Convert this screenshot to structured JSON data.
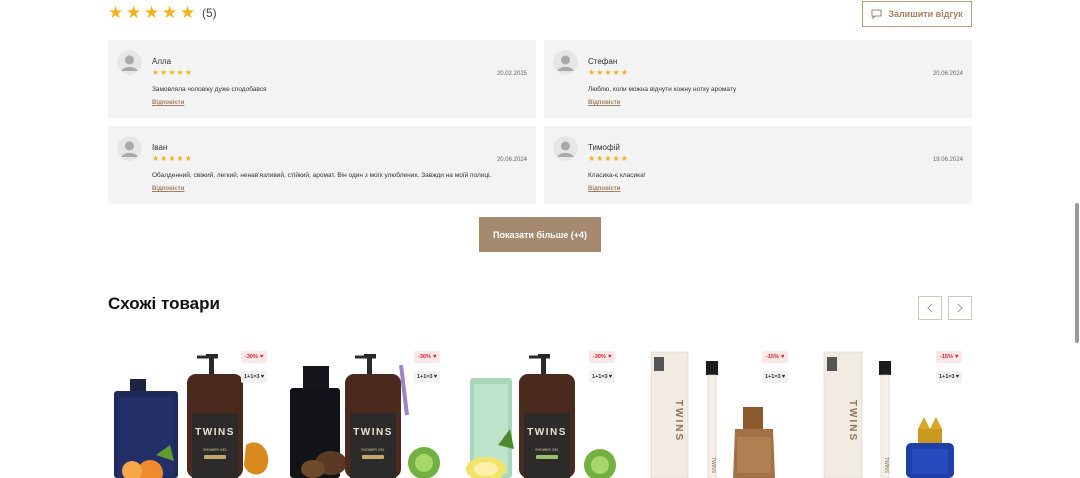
{
  "rating": {
    "stars": 5,
    "count_label": "(5)",
    "star_color": "#f2b21c"
  },
  "leave_review": {
    "label": "Залишити відгук",
    "icon": "comment-icon"
  },
  "reviews": [
    {
      "name": "Алла",
      "date": "20.02.2025",
      "text": "Замовляла чоловіку дуже сподобався",
      "reply": "Відповісти",
      "stars": 5
    },
    {
      "name": "Стефан",
      "date": "20.06.2024",
      "text": "Люблю, коли можна відчути кожну нотку аромату",
      "reply": "Відповісти",
      "stars": 5
    },
    {
      "name": "Іван",
      "date": "20.06.2024",
      "text": "Обалденний, свіжий, легкий, ненав'язливий, стійкий, аромат. Він один з моїх улюблених. Завжди на моїй полиці.",
      "reply": "Відповісти",
      "stars": 5
    },
    {
      "name": "Тимофій",
      "date": "19.06.2024",
      "text": "Класика-є класика!",
      "reply": "Відповісти",
      "stars": 5
    }
  ],
  "show_more": {
    "label": "Показати більше (+4)"
  },
  "similar": {
    "title": "Схожі товари",
    "prev_icon": "chevron-left-icon",
    "next_icon": "chevron-right-icon",
    "products": [
      {
        "sale": "-30%",
        "promo": "1+1=3"
      },
      {
        "sale": "-30%",
        "promo": "1+1=3"
      },
      {
        "sale": "-30%",
        "promo": "1+1=3"
      },
      {
        "sale": "-15%",
        "promo": "1+1=3"
      },
      {
        "sale": "-15%",
        "promo": "1+1=3"
      }
    ]
  },
  "colors": {
    "accent": "#a58a70",
    "accent_text": "#a57f60",
    "review_bg": "#f3f3f3",
    "sale": "#d9232e"
  }
}
